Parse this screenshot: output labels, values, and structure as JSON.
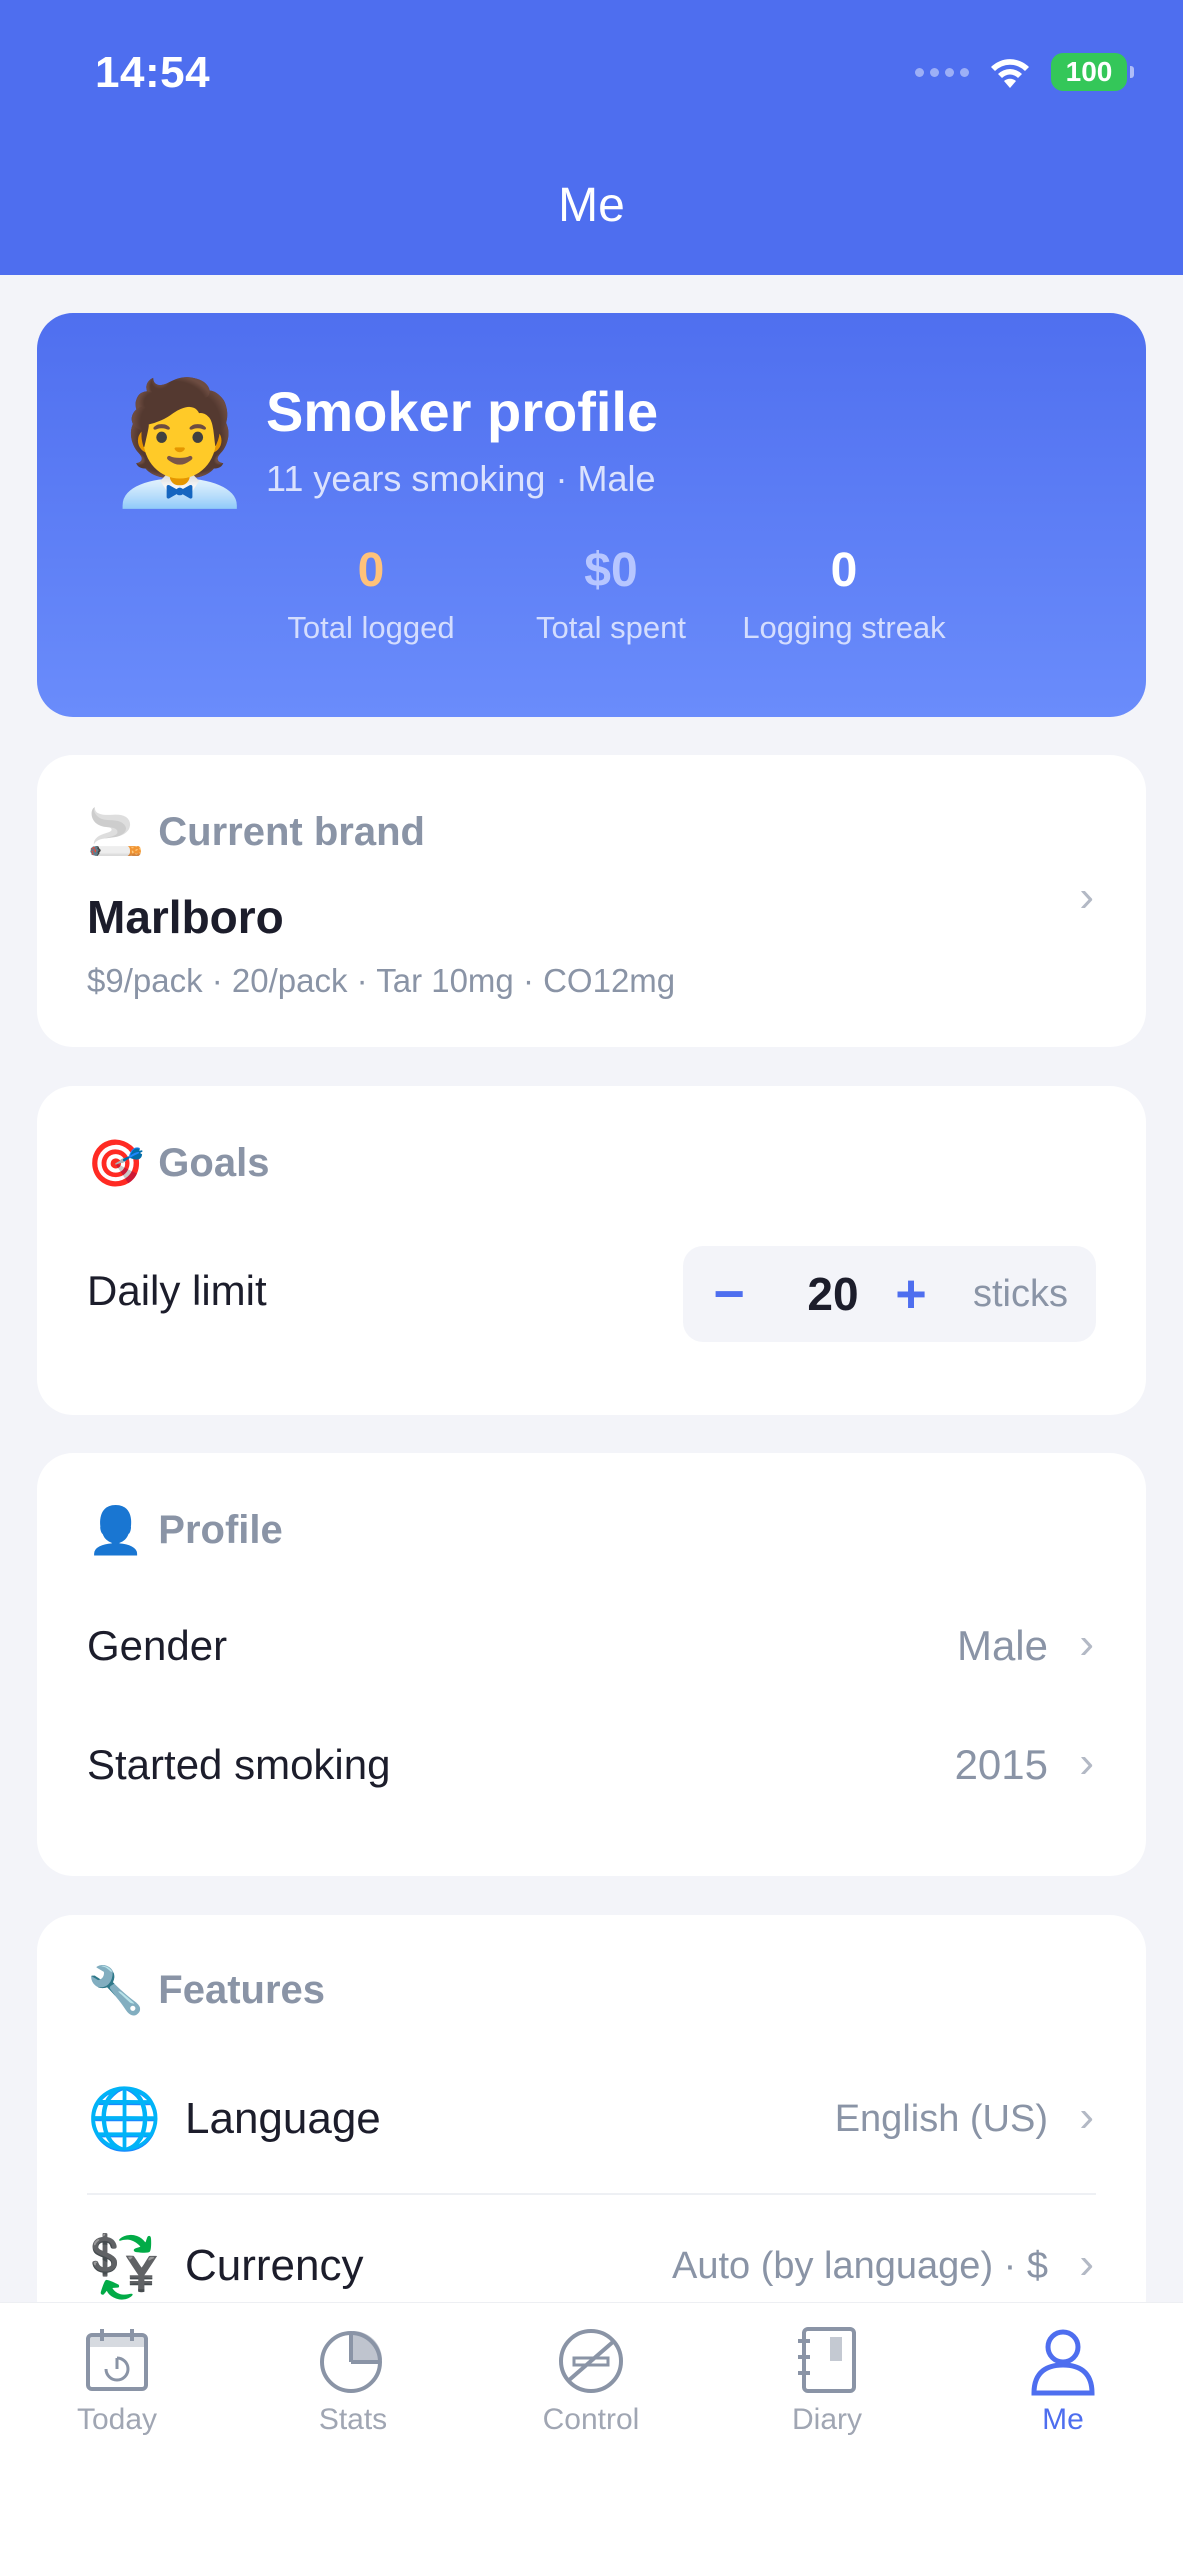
{
  "status_bar": {
    "time": "14:54",
    "battery": "100"
  },
  "nav": {
    "title": "Me"
  },
  "profile": {
    "avatar": "🧑‍💼",
    "title": "Smoker profile",
    "subtitle": "11 years smoking · Male",
    "stats": [
      {
        "value": "0",
        "label": "Total logged",
        "color": "#FFC27A"
      },
      {
        "value": "$0",
        "label": "Total spent",
        "color": "#B7C6FF"
      },
      {
        "value": "0",
        "label": "Logging streak",
        "color": "#FFFFFF"
      }
    ]
  },
  "brand": {
    "icon": "🚬",
    "section": "Current brand",
    "name": "Marlboro",
    "meta": "$9/pack · 20/pack · Tar 10mg · CO12mg"
  },
  "goals": {
    "icon": "🎯",
    "section": "Goals",
    "daily_limit_label": "Daily limit",
    "daily_limit_value": "20",
    "unit": "sticks"
  },
  "profile_section": {
    "icon": "👤",
    "section": "Profile",
    "gender_label": "Gender",
    "gender_value": "Male",
    "started_label": "Started smoking",
    "started_value": "2015"
  },
  "features": {
    "icon": "🔧",
    "section": "Features",
    "language_icon": "🌐",
    "language_label": "Language",
    "language_value": "English (US)",
    "currency_icon": "💱",
    "currency_label": "Currency",
    "currency_value": "Auto (by language) · $"
  },
  "tabs": [
    {
      "label": "Today",
      "icon": "calendar-icon"
    },
    {
      "label": "Stats",
      "icon": "pie-chart-icon"
    },
    {
      "label": "Control",
      "icon": "no-smoking-icon"
    },
    {
      "label": "Diary",
      "icon": "notebook-icon"
    },
    {
      "label": "Me",
      "icon": "person-icon",
      "active": true
    }
  ],
  "colors": {
    "accent": "#4E6EEF",
    "battery": "#34C759",
    "muted": "#8A94A6"
  }
}
